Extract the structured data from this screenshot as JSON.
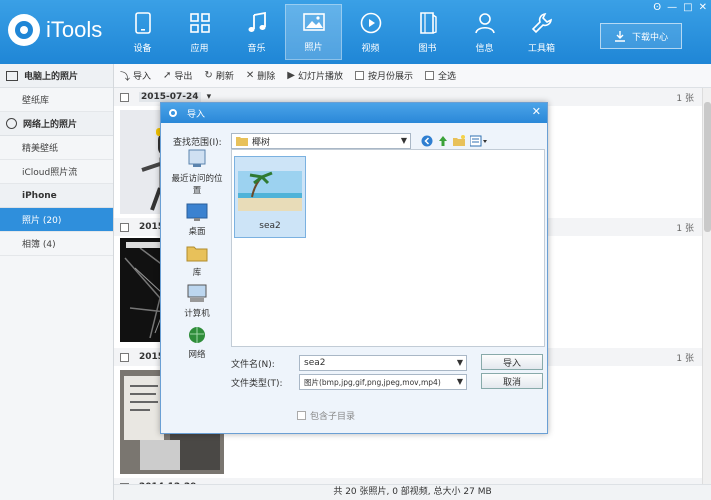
{
  "app": {
    "name": "iTools"
  },
  "window_controls": [
    "ʘ",
    "—",
    "□",
    "✕"
  ],
  "nav": [
    {
      "label": "设备",
      "icon": "phone-icon"
    },
    {
      "label": "应用",
      "icon": "apps-icon"
    },
    {
      "label": "音乐",
      "icon": "music-icon"
    },
    {
      "label": "照片",
      "icon": "photo-icon",
      "active": true
    },
    {
      "label": "视频",
      "icon": "video-icon"
    },
    {
      "label": "图书",
      "icon": "book-icon"
    },
    {
      "label": "信息",
      "icon": "user-icon"
    },
    {
      "label": "工具箱",
      "icon": "wrench-icon"
    }
  ],
  "download_center": "下载中心",
  "sidebar": {
    "sections": [
      {
        "title": "电脑上的照片",
        "items": [
          {
            "label": "壁纸库"
          }
        ]
      },
      {
        "title": "网络上的照片",
        "items": [
          {
            "label": "精美壁纸"
          },
          {
            "label": "iCloud照片流"
          }
        ]
      },
      {
        "title": "iPhone",
        "items": [
          {
            "label": "照片 (20)",
            "active": true
          },
          {
            "label": "相簿 (4)"
          }
        ]
      }
    ]
  },
  "toolbar": {
    "import": "导入",
    "export": "导出",
    "refresh": "刷新",
    "delete": "删除",
    "slideshow": "幻灯片播放",
    "by_month": "按月份展示",
    "select_all": "全选"
  },
  "groups": [
    {
      "date": "2015-07-24",
      "count": "1 张"
    },
    {
      "date": "2015-",
      "count": "1 张"
    },
    {
      "date": "2015-",
      "count": "1 张"
    },
    {
      "date": "2014-12-29",
      "count": ""
    }
  ],
  "status_bar": "共 20 张照片, 0 部视频, 总大小 27 MB",
  "dialog": {
    "title": "导入",
    "look_in_label": "查找范围(I):",
    "look_in_value": "椰树",
    "places": [
      "最近访问的位置",
      "桌面",
      "库",
      "计算机",
      "网络"
    ],
    "file_name": "sea2",
    "filename_label": "文件名(N):",
    "filename_value": "sea2",
    "filetype_label": "文件类型(T):",
    "filetype_value": "图片(bmp,jpg,gif,png,jpeg,mov,mp4)",
    "open_button": "导入",
    "cancel_button": "取消",
    "include_subdirs": "包含子目录"
  }
}
